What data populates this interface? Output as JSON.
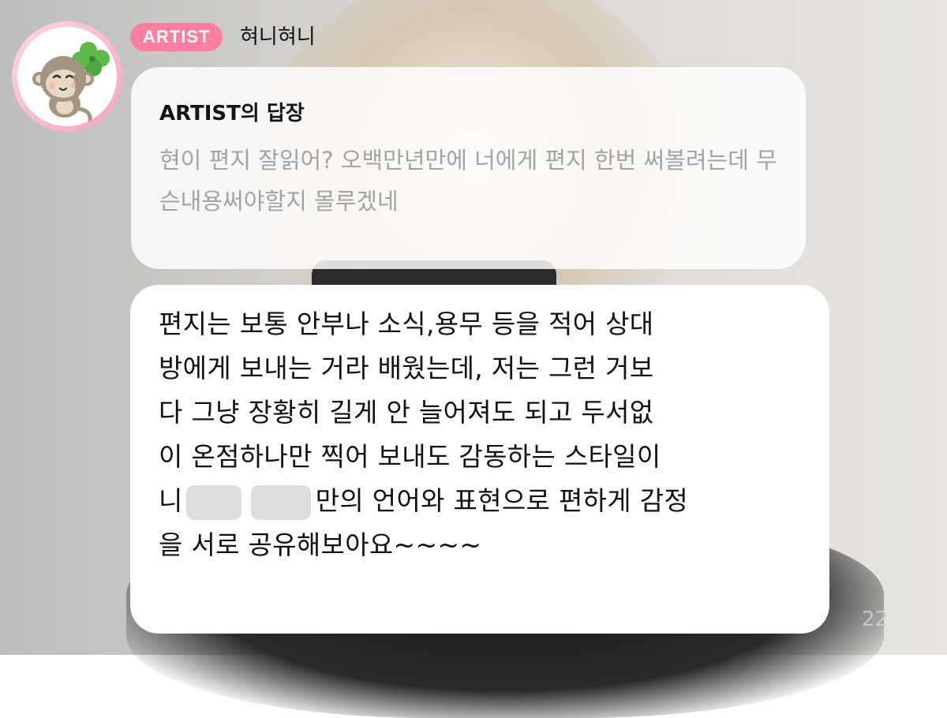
{
  "user": {
    "badge": "ARTIST",
    "name": "혀니혀니",
    "avatar_icon": "monkey-clover-icon"
  },
  "reply": {
    "title": "ARTIST의 답장",
    "text": "현이 편지 잘읽어? 오백만년만에 너에게 편지 한번 써볼려는데 무슨내용써야할지 몰루겠네"
  },
  "message": {
    "lines": [
      "편지는 보통 안부나 소식,용무 등을 적어 상대",
      "방에게 보내는 거라 배웠는데, 저는 그런 거보",
      "다 그냥 장황히 길게 안 늘어져도 되고 두서없",
      "이 온점하나만 찍어 보내도 감동하는 스타일이",
      "만의 언어와 표현으로 편하게 감정",
      "을 서로 공유해보아요~~~~"
    ],
    "line5_prefix": "니"
  },
  "timestamp": "22",
  "colors": {
    "badge": "#ff7f9f",
    "avatar_ring": "#f6a4c0"
  }
}
